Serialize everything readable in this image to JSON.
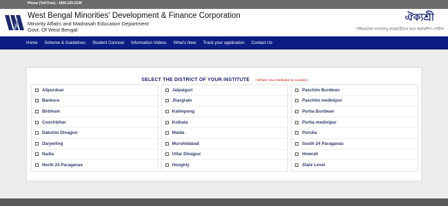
{
  "topbar": {
    "phone": "Phone (Toll Free) : 1800-120-2130"
  },
  "header": {
    "org_name": "West Bengal Minorities' Development & Finance Corporation",
    "department": "Minority Affairs and Madrasah Education Department",
    "government": "Govt. Of West Bengal",
    "brand_title": "ঐক্যশ্রী",
    "brand_tagline": "পশ্চিমবঙ্গের সংখ্যালঘু ছাত্রছাত্রীদের জন্য স্কলারশিপ পোর্টাল"
  },
  "nav": {
    "items": [
      "Home",
      "Scheme & Guidelines",
      "Student Conncet",
      "Information Videos",
      "What's New",
      "Track your application",
      "Contact Us"
    ]
  },
  "panel": {
    "title": "SELECT THE DISTRICT OF YOUR INSTITUTE",
    "hint": "( Where Your Institution Is Located )"
  },
  "districts": {
    "col1": [
      "Alipurduar",
      "Bankura",
      "Birbhum",
      "Coochbihar",
      "Dakshin Dinajpur",
      "Darjeeling",
      "Nadia",
      "North 24 Paraganas"
    ],
    "col2": [
      "Jalpaiguri",
      "Jhargram",
      "Kalimpong",
      "Kolkata",
      "Malda",
      "Murshidabad",
      "Uttar Dinajpur",
      "Hooghly"
    ],
    "col3": [
      "Paschim Burdwan",
      "Paschim medinipur",
      "Purba Burdwan",
      "Purba medinipur",
      "Purulia",
      "South 24 Paraganas",
      "Howrah",
      "State Level"
    ]
  },
  "colors": {
    "nav_bg": "#0b1c83",
    "title_text": "#1b1f6b",
    "hint_text": "#cc0000",
    "brand": "#1f2d7a"
  }
}
